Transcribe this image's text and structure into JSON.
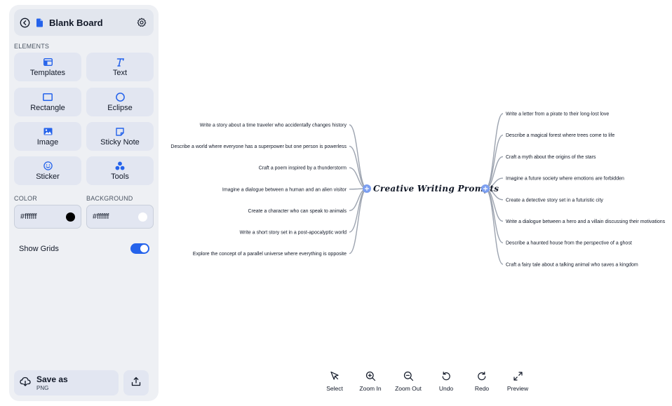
{
  "header": {
    "title": "Blank Board"
  },
  "elements": {
    "section_label": "ELEMENTS",
    "items": [
      {
        "label": "Templates",
        "icon": "layout-icon"
      },
      {
        "label": "Text",
        "icon": "text-icon"
      },
      {
        "label": "Rectangle",
        "icon": "rectangle-icon"
      },
      {
        "label": "Eclipse",
        "icon": "circle-icon"
      },
      {
        "label": "Image",
        "icon": "image-icon"
      },
      {
        "label": "Sticky Note",
        "icon": "sticky-note-icon"
      },
      {
        "label": "Sticker",
        "icon": "smiley-icon"
      },
      {
        "label": "Tools",
        "icon": "tools-icon"
      }
    ]
  },
  "color": {
    "label": "COLOR",
    "value": "#ffffff",
    "swatch": "#000000"
  },
  "background": {
    "label": "BACKGROUND",
    "value": "#ffffff",
    "swatch": "#ffffff"
  },
  "grids": {
    "label": "Show Grids",
    "enabled": true
  },
  "save": {
    "label": "Save as",
    "format": "PNG"
  },
  "mindmap": {
    "title": "Creative Writing Prompts",
    "left": [
      "Write a story about a time traveler who accidentally changes history",
      "Describe a world where everyone has a superpower but one person is powerless",
      "Craft a poem inspired by a thunderstorm",
      "Imagine a dialogue between a human and an alien visitor",
      "Create a character who can speak to animals",
      "Write a short story set in a post-apocalyptic world",
      "Explore the concept of a parallel universe where everything is opposite"
    ],
    "right": [
      "Write a letter from a pirate to their long-lost love",
      "Describe a magical forest where trees come to life",
      "Craft a myth about the origins of the stars",
      "Imagine a future society where emotions are forbidden",
      "Create a detective story set in a futuristic city",
      "Write a dialogue between a hero and a villain discussing their motivations",
      "Describe a haunted house from the perspective of a ghost",
      "Craft a fairy tale about a talking animal who saves a kingdom"
    ]
  },
  "toolbar": {
    "select": "Select",
    "zoom_in": "Zoom In",
    "zoom_out": "Zoom Out",
    "undo": "Undo",
    "redo": "Redo",
    "preview": "Preview"
  },
  "colors": {
    "accent": "#2563eb",
    "node": "#7c9ff0",
    "branch": "#9ca3af",
    "panel": "#eef0f4",
    "tile": "#e2e6f1"
  }
}
